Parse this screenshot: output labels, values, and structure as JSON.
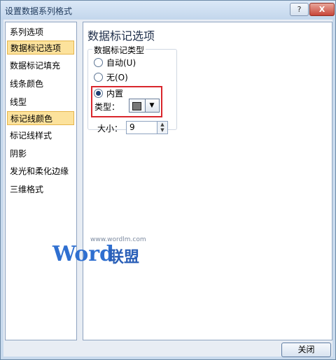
{
  "window": {
    "title": "设置数据系列格式",
    "help_glyph": "?",
    "close_glyph": "X"
  },
  "sidebar": {
    "items": [
      {
        "label": "系列选项",
        "selected": false
      },
      {
        "label": "数据标记选项",
        "selected": true
      },
      {
        "label": "数据标记填充",
        "selected": false
      },
      {
        "label": "线条颜色",
        "selected": false
      },
      {
        "label": "线型",
        "selected": false
      },
      {
        "label": "标记线颜色",
        "selected": true
      },
      {
        "label": "标记线样式",
        "selected": false
      },
      {
        "label": "阴影",
        "selected": false
      },
      {
        "label": "发光和柔化边缘",
        "selected": false
      },
      {
        "label": "三维格式",
        "selected": false
      }
    ]
  },
  "main": {
    "section_title": "数据标记选项",
    "group_label": "数据标记类型",
    "radio_auto": "自动(U)",
    "radio_none": "无(O)",
    "radio_builtin": "内置",
    "selected_option": "内置",
    "type_label": "类型：",
    "size_label": "大小：",
    "size_value": "9",
    "marker_color": "#777777"
  },
  "watermark": {
    "url": "www.wordlm.com",
    "word": "Word",
    "cn": "联盟"
  },
  "footer": {
    "close_label": "关闭"
  }
}
